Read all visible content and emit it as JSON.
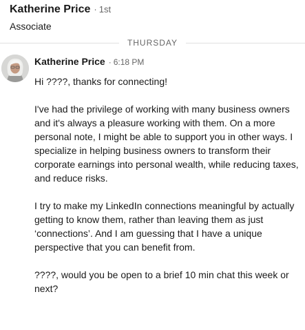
{
  "header": {
    "name": "Katherine Price",
    "separator": "·",
    "degree": "1st",
    "headline": "Associate"
  },
  "divider": {
    "day": "THURSDAY"
  },
  "message": {
    "sender": "Katherine Price",
    "separator": "·",
    "time": "6:18 PM",
    "avatar_icon": "profile-photo",
    "paragraphs": [
      "Hi ????, thanks for connecting!",
      "I've had the privilege of working with many business owners and it's always a pleasure working with them. On a more personal note, I might be able to support you in other ways. I specialize in helping business owners to transform their corporate earnings into personal wealth, while reducing taxes, and reduce risks.",
      "I try to make my LinkedIn connections meaningful by actually getting to know them, rather than leaving them as just ‘connections’. And I am guessing that I have a unique perspective that you can benefit from.",
      "????, would you be open to a brief 10 min chat this week or next?"
    ]
  }
}
